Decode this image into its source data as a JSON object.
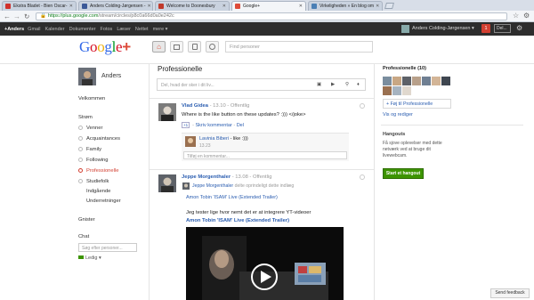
{
  "browser": {
    "tabs": [
      {
        "title": "Ekstra Bladet - Bien Oscar-",
        "color": "#d0312d",
        "active": false
      },
      {
        "title": "Anders Colding-Jørgensen -",
        "color": "#3b5998",
        "active": false
      },
      {
        "title": "Welcome to Doonesbury",
        "color": "#c0392b",
        "active": false
      },
      {
        "title": "Google+",
        "color": "#dd4b39",
        "active": true
      },
      {
        "title": "Virkeligheden » En blog om",
        "color": "#4a7fb5",
        "active": false
      }
    ],
    "url_scheme": "https://",
    "url_host": "plus.google.com",
    "url_path": "/stream/circles/p8c0a66d0a0e242c"
  },
  "gbar": {
    "plus": "+Anders",
    "items": [
      "Gmail",
      "Kalender",
      "Dokumenter",
      "Fotos",
      "Læser",
      "Nettet",
      "mere ▾"
    ],
    "user": "Anders Colding-Jørgensen ▾",
    "notif": "1",
    "share": "Del..."
  },
  "header": {
    "find_placeholder": "Find personer"
  },
  "left": {
    "name": "Anders",
    "welcome": "Velkommen",
    "stream": "Strøm",
    "circles": [
      {
        "label": "Venner",
        "active": false
      },
      {
        "label": "Acquaintances",
        "active": false
      },
      {
        "label": "Family",
        "active": false
      },
      {
        "label": "Following",
        "active": false
      },
      {
        "label": "Professionelle",
        "active": true
      },
      {
        "label": "Studiefolk",
        "active": false
      }
    ],
    "incoming": "Indgående",
    "notifications": "Underretninger",
    "sparks": "Gnister",
    "chat": "Chat",
    "chat_placeholder": "Søg efter personer...",
    "status": "Ledig"
  },
  "center": {
    "title": "Professionelle",
    "share_placeholder": "Del, hvad der sker i dit liv...",
    "post1": {
      "author": "Vlad Gidea",
      "time": "13.10",
      "vis": "Offentlig",
      "text": "Where is the like button on these updates? :))) </joke>",
      "plus": "+1",
      "comment": "Skriv kommentar",
      "share": "Del",
      "reply_author": "Lavinia Biberi",
      "reply_text": "- like :)))",
      "reply_time": "13.23",
      "add_comment": "Tilføj en kommentar..."
    },
    "post2": {
      "author": "Jeppe Morgenthaler",
      "time": "13.08",
      "vis": "Offentlig",
      "reshare_author": "Jeppe Morgenthaler",
      "reshare_text": "delte oprindeligt dette indlæg",
      "link1": "Amon Tobin 'ISAM' Live (Extended Trailer)",
      "text": "Jeg tester lige hvor nemt det er at integrere YT-videoer",
      "link2": "Amon Tobin 'ISAM' Live (Extended Trailer)"
    }
  },
  "right": {
    "circle_title": "Professionelle (10)",
    "add_link": "+ Føj til Professionelle",
    "view_edit": "Vis og rediger",
    "hangouts_title": "Hangouts",
    "hangouts_text": "Få sjove oplevelser med dette netværk ved at bruge dit livewebcam.",
    "hangout_btn": "Start et hangout",
    "feedback": "Send feedback"
  },
  "colors": {
    "accent": "#dd4b39",
    "link": "#2a5db0",
    "green": "#3d9400"
  }
}
